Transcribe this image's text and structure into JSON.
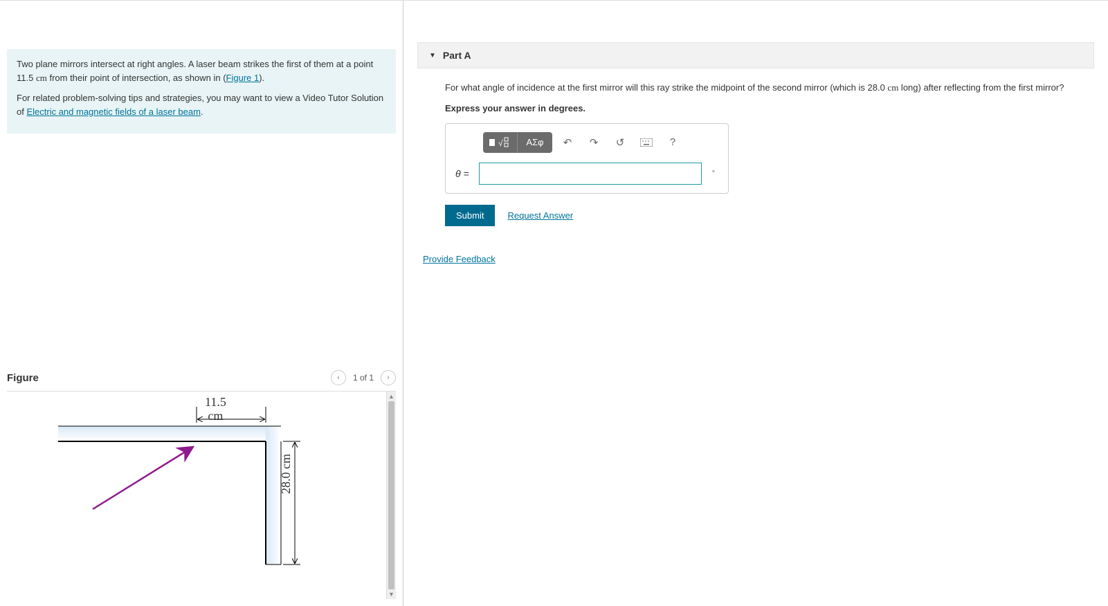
{
  "problem": {
    "para1_a": "Two plane mirrors intersect at right angles. A laser beam strikes the first of them at a point 11.5 ",
    "para1_unit": "cm",
    "para1_b": " from their point of intersection, as shown in (",
    "figure_link": "Figure 1",
    "para1_c": ").",
    "para2_a": "For related problem-solving tips and strategies, you may want to view a Video Tutor Solution of ",
    "tutor_link": "Electric and magnetic fields of a laser beam",
    "para2_b": "."
  },
  "figure": {
    "title": "Figure",
    "page_indicator": "1 of 1",
    "dim_top": "11.5\ncm",
    "dim_side": "28.0 cm"
  },
  "part": {
    "label": "Part A",
    "question_a": "For what angle of incidence at the first mirror will this ray strike the midpoint of the second mirror (which is 28.0 ",
    "question_unit": "cm",
    "question_b": " long) after reflecting from the first mirror?",
    "instruction": "Express your answer in degrees.",
    "var": "θ =",
    "unit": "°",
    "tool_greek": "ΑΣφ",
    "submit": "Submit",
    "request": "Request Answer"
  },
  "feedback": "Provide Feedback"
}
